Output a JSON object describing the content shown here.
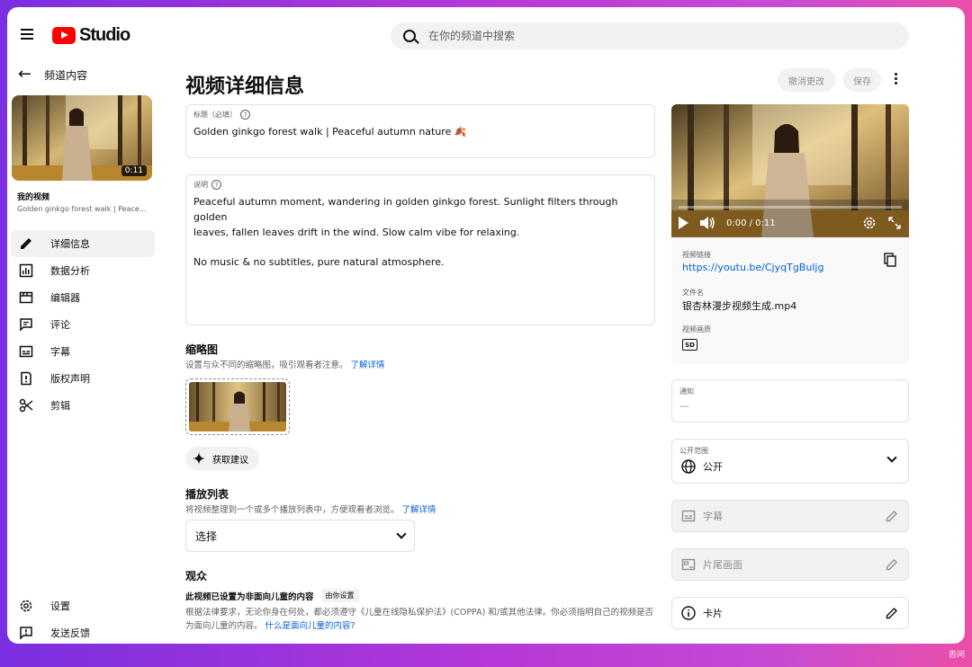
{
  "app": {
    "logo_text": "Studio",
    "brand_color": "#ff0000",
    "link_color": "#065fd4"
  },
  "search": {
    "placeholder": "在你的频道中搜索"
  },
  "sidebar": {
    "back_label": "频道内容",
    "thumb_duration": "0:11",
    "my_video_label": "我的视频",
    "video_title_short": "Golden ginkgo forest walk | Peace...",
    "items": [
      {
        "label": "详细信息",
        "icon": "pencil-icon",
        "active": true
      },
      {
        "label": "数据分析",
        "icon": "analytics-icon"
      },
      {
        "label": "编辑器",
        "icon": "editor-icon"
      },
      {
        "label": "评论",
        "icon": "comment-icon"
      },
      {
        "label": "字幕",
        "icon": "subtitles-icon"
      },
      {
        "label": "版权声明",
        "icon": "copyright-icon"
      },
      {
        "label": "剪辑",
        "icon": "scissors-icon"
      }
    ],
    "settings_label": "设置",
    "feedback_label": "发送反馈"
  },
  "main": {
    "title": "视频详细信息",
    "undo_label": "撤消更改",
    "save_label": "保存",
    "title_field": {
      "label": "标题（必填）",
      "value": "Golden ginkgo forest walk | Peaceful autumn nature",
      "emoji": "🍂"
    },
    "description_field": {
      "label": "说明",
      "line1": "Peaceful autumn moment, wandering in golden ginkgo forest. Sunlight filters through golden",
      "line2": "leaves, fallen leaves drift in the wind. Slow calm vibe for relaxing.",
      "line3": "No music & no subtitles, pure natural atmosphere."
    },
    "thumbnail": {
      "title": "缩略图",
      "desc": "设置与众不同的缩略图，吸引观看者注意。",
      "link": "了解详情",
      "suggest_label": "获取建议"
    },
    "playlist": {
      "title": "播放列表",
      "desc": "将视频整理到一个或多个播放列表中，方便观看者浏览。",
      "link": "了解详情",
      "select_value": "选择"
    },
    "audience": {
      "title": "观众",
      "status": "此视频已设置为非面向儿童的内容",
      "badge": "由你设置",
      "legal_text": "根据法律要求，无论你身在何处，都必须遵守《儿童在线隐私保护法》(COPPA) 和/或其他法律。你必须指明自己的视频是否为面向儿童的内容。",
      "legal_link": "什么是面向儿童的内容?"
    }
  },
  "right": {
    "player_time": "0:00 / 0:11",
    "link_label": "视频链接",
    "link_value": "https://youtu.be/CjyqTgBuljg",
    "file_label": "文件名",
    "file_value": "银杏林漫步视频生成.mp4",
    "quality_label": "视频画质",
    "quality_badge": "SD",
    "notification_label": "通知",
    "notification_value": "—",
    "visibility_label": "公开范围",
    "visibility_value": "公开",
    "subtitles_label": "字幕",
    "endscreen_label": "片尾画面",
    "cards_label": "卡片"
  },
  "corner_text": "否问"
}
